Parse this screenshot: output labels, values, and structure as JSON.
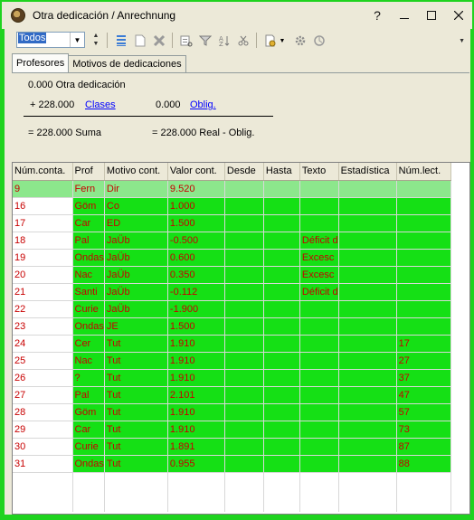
{
  "window": {
    "title": "Otra dedicación / Anrechnung"
  },
  "toolbar": {
    "filter_value": "Todos"
  },
  "tabs": [
    "Profesores",
    "Motivos de dedicaciones"
  ],
  "summary": {
    "otra": "0.000 Otra dedicación",
    "clases_value": "+ 228.000",
    "clases_link": "Clases",
    "oblig_value": "0.000",
    "oblig_link": "Oblig.",
    "suma": "= 228.000 Suma",
    "real": "= 228.000 Real - Oblig."
  },
  "colors": {
    "row_green": "#15e015",
    "selected_row": "#8ce78c",
    "cell_text": "#c80000",
    "window_border": "#1fd31f"
  },
  "table": {
    "headers": [
      "Núm.conta.",
      "Prof",
      "Motivo cont.",
      "Valor cont.",
      "Desde",
      "Hasta",
      "Texto",
      "Estadística",
      "Núm.lect."
    ],
    "rows": [
      [
        "9",
        "Fern",
        "Dir",
        "9.520",
        "",
        "",
        "",
        "",
        ""
      ],
      [
        "16",
        "Göm",
        "Co",
        "1.000",
        "",
        "",
        "",
        "",
        ""
      ],
      [
        "17",
        "Car",
        "ED",
        "1.500",
        "",
        "",
        "",
        "",
        ""
      ],
      [
        "18",
        "Pal",
        "JaÜb",
        "-0.500",
        "",
        "",
        "Déficit d",
        "",
        ""
      ],
      [
        "19",
        "Ondas",
        "JaÜb",
        "0.600",
        "",
        "",
        "Excesc",
        "",
        ""
      ],
      [
        "20",
        "Nac",
        "JaÜb",
        "0.350",
        "",
        "",
        "Excesc",
        "",
        ""
      ],
      [
        "21",
        "Santi",
        "JaÜb",
        "-0.112",
        "",
        "",
        "Déficit d",
        "",
        ""
      ],
      [
        "22",
        "Curie",
        "JaÜb",
        "-1.900",
        "",
        "",
        "",
        "",
        ""
      ],
      [
        "23",
        "Ondas",
        "JE",
        "1.500",
        "",
        "",
        "",
        "",
        ""
      ],
      [
        "24",
        "Cer",
        "Tut",
        "1.910",
        "",
        "",
        "",
        "",
        "17"
      ],
      [
        "25",
        "Nac",
        "Tut",
        "1.910",
        "",
        "",
        "",
        "",
        "27"
      ],
      [
        "26",
        "?",
        "Tut",
        "1.910",
        "",
        "",
        "",
        "",
        "37"
      ],
      [
        "27",
        "Pal",
        "Tut",
        "2.101",
        "",
        "",
        "",
        "",
        "47"
      ],
      [
        "28",
        "Göm",
        "Tut",
        "1.910",
        "",
        "",
        "",
        "",
        "57"
      ],
      [
        "29",
        "Car",
        "Tut",
        "1.910",
        "",
        "",
        "",
        "",
        "73"
      ],
      [
        "30",
        "Curie",
        "Tut",
        "1.891",
        "",
        "",
        "",
        "",
        "87"
      ],
      [
        "31",
        "Ondas",
        "Tut",
        "0.955",
        "",
        "",
        "",
        "",
        "88"
      ]
    ]
  }
}
